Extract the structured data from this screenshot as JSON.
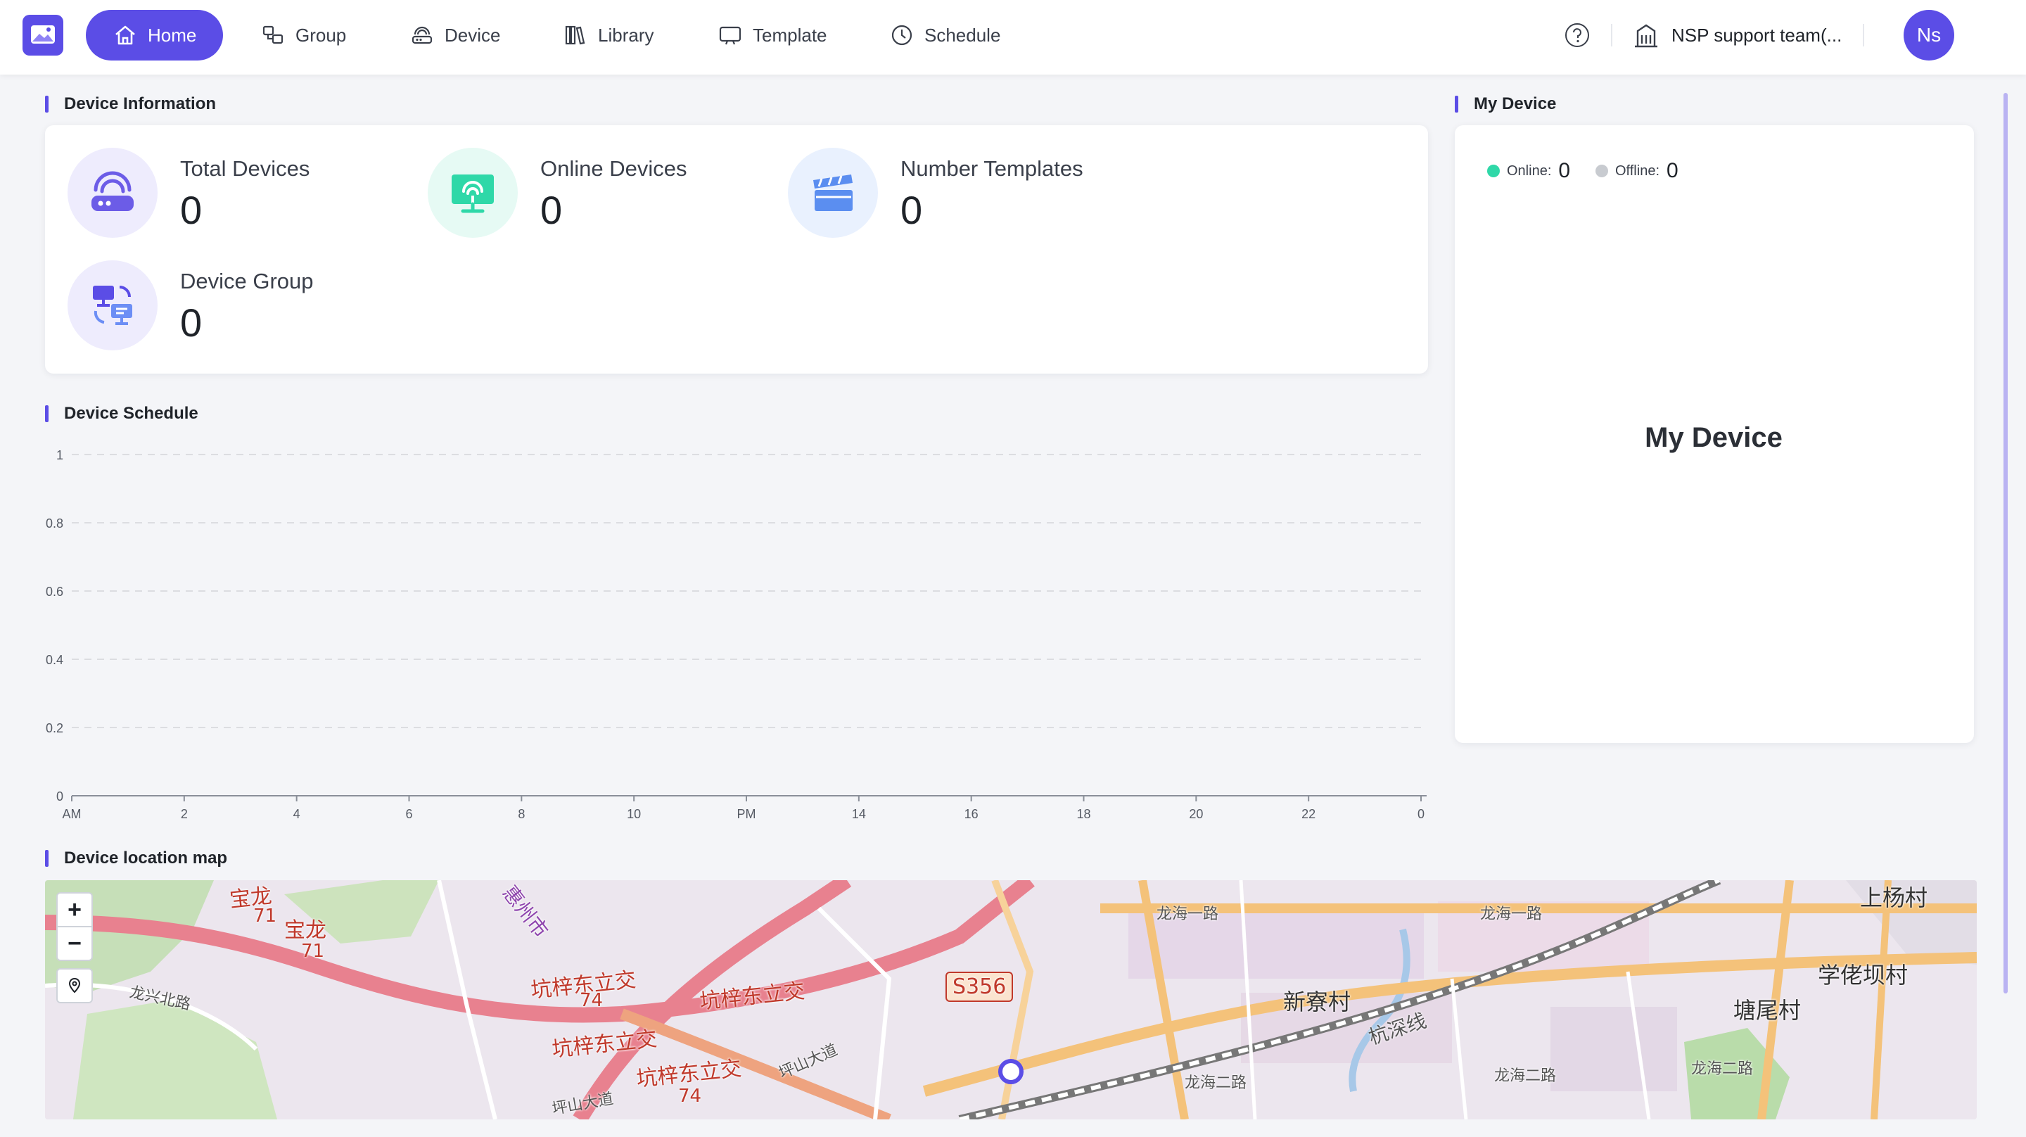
{
  "nav": {
    "items": [
      {
        "label": "Home",
        "icon": "home-icon",
        "active": true
      },
      {
        "label": "Group",
        "icon": "group-icon",
        "active": false
      },
      {
        "label": "Device",
        "icon": "device-icon",
        "active": false
      },
      {
        "label": "Library",
        "icon": "library-icon",
        "active": false
      },
      {
        "label": "Template",
        "icon": "template-icon",
        "active": false
      },
      {
        "label": "Schedule",
        "icon": "clock-icon",
        "active": false
      }
    ],
    "team_name": "NSP support team(...",
    "avatar_initials": "Ns",
    "accent_color": "#5b4de6"
  },
  "device_info": {
    "title": "Device Information",
    "stats": [
      {
        "label": "Total Devices",
        "value": "0",
        "icon": "router-icon"
      },
      {
        "label": "Online Devices",
        "value": "0",
        "icon": "monitor-signal-icon"
      },
      {
        "label": "Number Templates",
        "value": "0",
        "icon": "clapperboard-icon"
      },
      {
        "label": "Device Group",
        "value": "0",
        "icon": "device-group-icon"
      }
    ]
  },
  "my_device": {
    "title": "My Device",
    "online_label": "Online:",
    "online_value": "0",
    "online_color": "#2fd8a8",
    "offline_label": "Offline:",
    "offline_value": "0",
    "offline_color": "#c8cbd0",
    "center_text": "My Device"
  },
  "schedule": {
    "title": "Device Schedule"
  },
  "chart_data": {
    "type": "line",
    "x_tick_labels": [
      "AM",
      "2",
      "4",
      "6",
      "8",
      "10",
      "PM",
      "14",
      "16",
      "18",
      "20",
      "22",
      "0"
    ],
    "y_tick_labels": [
      "0",
      "0.2",
      "0.4",
      "0.6",
      "0.8",
      "1"
    ],
    "ylim": [
      0,
      1
    ],
    "grid": true,
    "series": []
  },
  "map": {
    "title": "Device location map",
    "zoom_in_label": "+",
    "zoom_out_label": "−",
    "locate_icon": "location-pin-icon",
    "labels": [
      {
        "text": "宝龙",
        "color": "#c0392b"
      },
      {
        "text": "宝龙",
        "color": "#c0392b"
      },
      {
        "text": "71",
        "color": "#c0392b"
      },
      {
        "text": "71",
        "color": "#c0392b"
      },
      {
        "text": "惠州市",
        "color": "#8e44ad"
      },
      {
        "text": "坑梓东立交",
        "color": "#c0392b"
      },
      {
        "text": "坑梓东立交",
        "color": "#c0392b"
      },
      {
        "text": "坑梓东立交",
        "color": "#c0392b"
      },
      {
        "text": "坑梓东立交",
        "color": "#c0392b"
      },
      {
        "text": "74",
        "color": "#c0392b"
      },
      {
        "text": "74",
        "color": "#c0392b"
      },
      {
        "text": "S356",
        "color": "#c0392b"
      },
      {
        "text": "龙兴北路",
        "color": "#555555"
      },
      {
        "text": "新寮村",
        "color": "#333333"
      },
      {
        "text": "上杨村",
        "color": "#333333"
      },
      {
        "text": "学佬坝村",
        "color": "#333333"
      },
      {
        "text": "塘尾村",
        "color": "#333333"
      },
      {
        "text": "龙海一路",
        "color": "#555555"
      },
      {
        "text": "龙海一路",
        "color": "#555555"
      },
      {
        "text": "龙海二路",
        "color": "#555555"
      },
      {
        "text": "龙海二路",
        "color": "#555555"
      },
      {
        "text": "龙海二路",
        "color": "#555555"
      },
      {
        "text": "杭深线",
        "color": "#555555"
      },
      {
        "text": "坪山大道",
        "color": "#555555"
      },
      {
        "text": "坪山大道",
        "color": "#555555"
      }
    ]
  }
}
